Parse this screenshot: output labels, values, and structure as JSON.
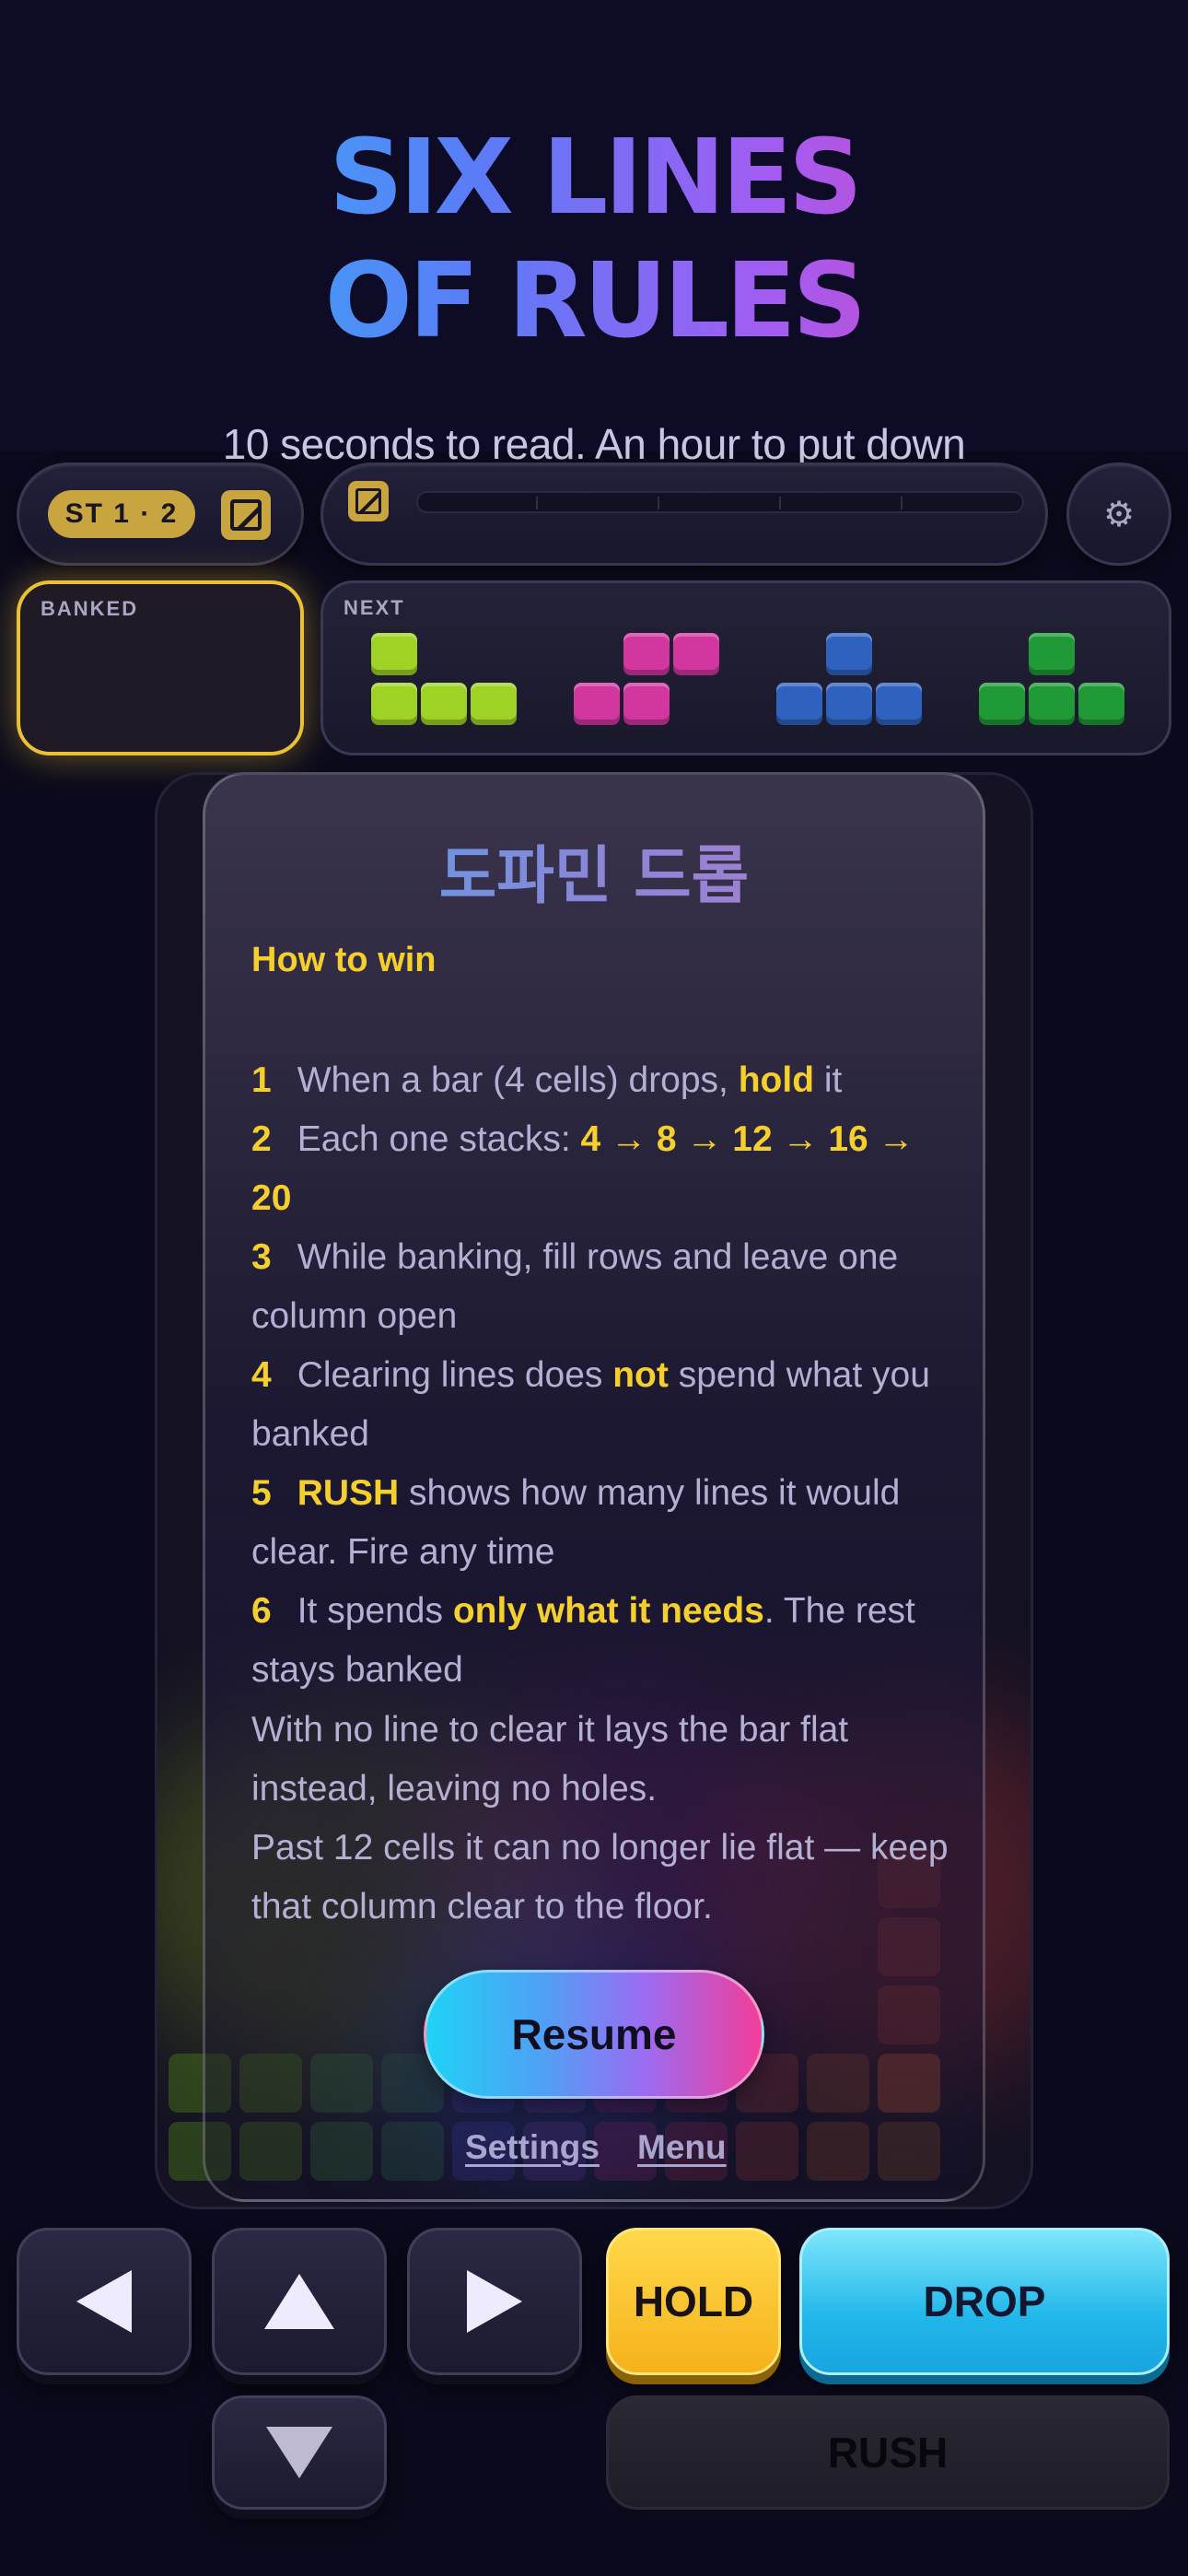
{
  "header": {
    "title_line1": "SIX LINES",
    "title_line2": "OF RULES",
    "subtitle": "10 seconds to read. An hour to put down"
  },
  "topbar": {
    "stage_badge": "ST 1 · 2",
    "edit_icon": "edit-icon",
    "settings_icon": "gear-icon",
    "progress_fraction": 0.0
  },
  "banked": {
    "label": "BANKED"
  },
  "next": {
    "label": "NEXT",
    "pieces": [
      {
        "shape": "J",
        "color": "#9ed224"
      },
      {
        "shape": "S",
        "color": "#d2369f"
      },
      {
        "shape": "T",
        "color": "#2f62bf"
      },
      {
        "shape": "T",
        "color": "#1f9a36"
      }
    ]
  },
  "card": {
    "title": "도파민 드롭",
    "section": "How to win",
    "rules": [
      {
        "n": "1",
        "parts": [
          {
            "t": "When a bar (4 cells) drops, "
          },
          {
            "t": "hold",
            "hl": true
          },
          {
            "t": " it"
          }
        ]
      },
      {
        "n": "2",
        "parts": [
          {
            "t": "Each one stacks: "
          },
          {
            "t": "4 → 8 → 12 → 16 → 20",
            "hl": true
          }
        ]
      },
      {
        "n": "3",
        "parts": [
          {
            "t": "While banking, fill rows and leave one column open"
          }
        ]
      },
      {
        "n": "4",
        "parts": [
          {
            "t": "Clearing lines does "
          },
          {
            "t": "not",
            "hl": true
          },
          {
            "t": " spend what you banked"
          }
        ]
      },
      {
        "n": "5",
        "parts": [
          {
            "t": "RUSH",
            "hl": true
          },
          {
            "t": " shows how many lines it would clear. Fire any time"
          }
        ]
      },
      {
        "n": "6",
        "parts": [
          {
            "t": "It spends "
          },
          {
            "t": "only what it needs",
            "hl": true
          },
          {
            "t": ". The rest stays banked"
          }
        ]
      }
    ],
    "note1": "With no line to clear it lays the bar flat instead, leaving no holes.",
    "note2": "Past 12 cells it can no longer lie flat — keep that column clear to the floor.",
    "resume_label": "Resume",
    "settings_link": "Settings",
    "menu_link": "Menu"
  },
  "controls": {
    "left_icon": "left-arrow-icon",
    "rotate_icon": "up-arrow-icon",
    "right_icon": "right-arrow-icon",
    "down_icon": "down-arrow-icon",
    "hold_label": "HOLD",
    "drop_label": "DROP",
    "rush_label": "RUSH"
  }
}
